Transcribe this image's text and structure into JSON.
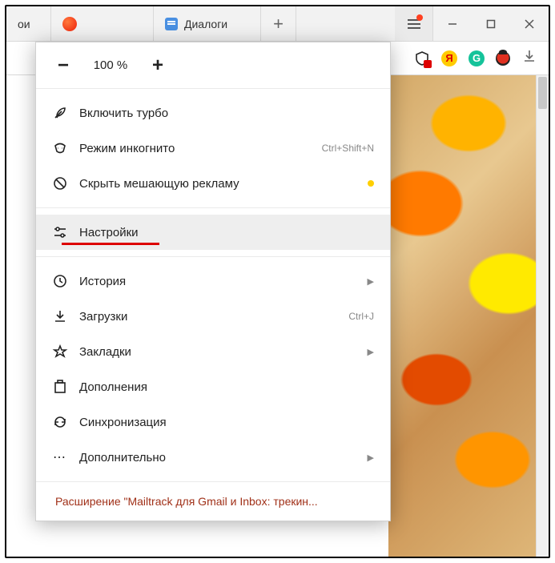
{
  "titlebar": {
    "tab1_fragment": "ои",
    "tab2_label": "Диалоги"
  },
  "zoom": {
    "value": "100 %",
    "minus": "−",
    "plus": "+"
  },
  "menu": {
    "turbo": "Включить турбо",
    "incognito": "Режим инкогнито",
    "incognito_shortcut": "Ctrl+Shift+N",
    "hide_ads": "Скрыть мешающую рекламу",
    "settings": "Настройки",
    "history": "История",
    "downloads": "Загрузки",
    "downloads_shortcut": "Ctrl+J",
    "bookmarks": "Закладки",
    "addons": "Дополнения",
    "sync": "Синхронизация",
    "more": "Дополнительно"
  },
  "footer": {
    "extension_notice": "Расширение \"Mailtrack для Gmail и Inbox: трекин..."
  },
  "toolbar": {
    "yandex_glyph": "Я",
    "grammarly_glyph": "G"
  }
}
